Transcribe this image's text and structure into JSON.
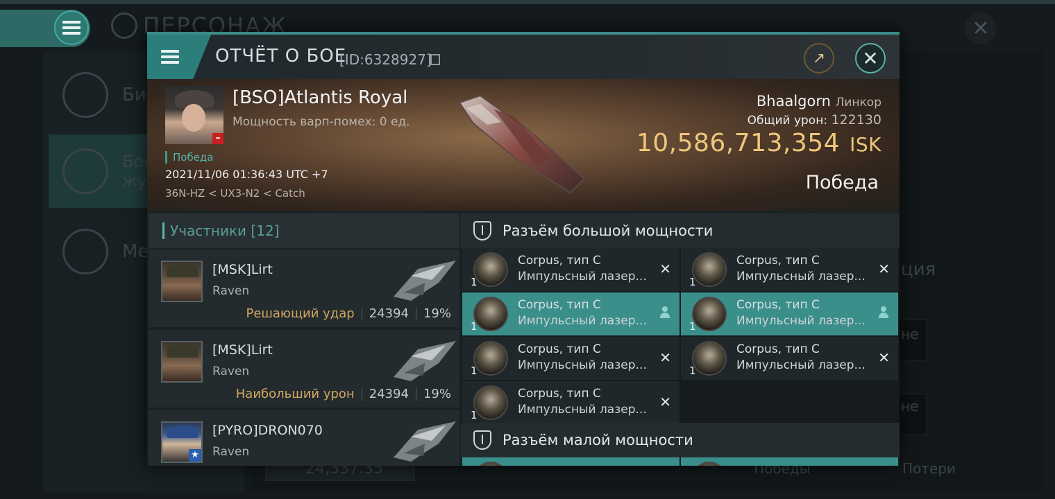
{
  "background": {
    "title": "ПЕРСОНАЖ",
    "sidebar": [
      {
        "label": "Био",
        "icon": "list-icon"
      },
      {
        "label": "Бое\nжур",
        "icon": "crossed-swords-icon"
      },
      {
        "label": "Мед",
        "icon": "star-medal-icon"
      }
    ],
    "right_partial": "ция",
    "partial_ne_1": "не",
    "partial_ne_2": "не",
    "bottom_value": "24,337.35",
    "kills_label": "Победы",
    "losses_label": "Потери"
  },
  "report": {
    "title": "ОТЧЁТ О БОЕ",
    "id": "[ID:6328927]",
    "pilot": "[BSO]Atlantis Royal",
    "warp": "Мощность варп-помех: 0 ед.",
    "victory_tag": "Победа",
    "datetime": "2021/11/06 01:36:43 UTC +7",
    "location": "36N-HZ < UX3-N2 < Catch",
    "ship_name": "Bhaalgorn",
    "ship_class": "Линкор",
    "total_damage_label": "Общий урон:",
    "total_damage": "122130",
    "isk_value": "10,586,713,354",
    "isk_unit": "ISK",
    "result": "Победа"
  },
  "participants": {
    "title": "Участники [12]",
    "rows": [
      {
        "name": "[MSK]Lirt",
        "ship": "Raven",
        "role": "Решающий удар",
        "damage": "24394",
        "percent": "19%"
      },
      {
        "name": "[MSK]Lirt",
        "ship": "Raven",
        "role": "Наибольший урон",
        "damage": "24394",
        "percent": "19%"
      },
      {
        "name": "[PYRO]DRON070",
        "ship": "Raven",
        "role": "",
        "damage": "",
        "percent": ""
      }
    ]
  },
  "slots": {
    "high_title": "Разъём большой мощности",
    "low_title": "Разъём малой мощности",
    "high_modules": [
      {
        "qty": "1",
        "name": "Corpus, тип C",
        "type": "Импульсный лазер...",
        "state": "destroyed"
      },
      {
        "qty": "1",
        "name": "Corpus, тип C",
        "type": "Импульсный лазер...",
        "state": "destroyed"
      },
      {
        "qty": "1",
        "name": "Corpus, тип C",
        "type": "Импульсный лазер...",
        "state": "dropped"
      },
      {
        "qty": "1",
        "name": "Corpus, тип C",
        "type": "Импульсный лазер...",
        "state": "dropped"
      },
      {
        "qty": "1",
        "name": "Corpus, тип C",
        "type": "Импульсный лазер...",
        "state": "destroyed"
      },
      {
        "qty": "1",
        "name": "Corpus, тип C",
        "type": "Импульсный лазер...",
        "state": "destroyed"
      },
      {
        "qty": "1",
        "name": "Corpus, тип C",
        "type": "Импульсный лазер...",
        "state": "destroyed"
      }
    ]
  },
  "colors": {
    "accent": "#3c8a87",
    "isk": "#eec77a",
    "role": "#d2a85e",
    "active_module": "#3a8f8b"
  }
}
